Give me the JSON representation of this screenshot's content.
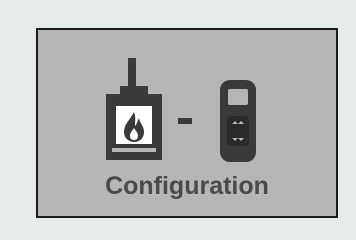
{
  "tile": {
    "label": "Configuration",
    "separator": "-",
    "icons": [
      "stove-icon",
      "remote-control-icon"
    ]
  },
  "colors": {
    "background": "#e6ecec",
    "tile_fill": "#b6b6b6",
    "tile_border": "#1c1c1c",
    "icon": "#3a3a3a",
    "label": "#4a4a4a"
  }
}
